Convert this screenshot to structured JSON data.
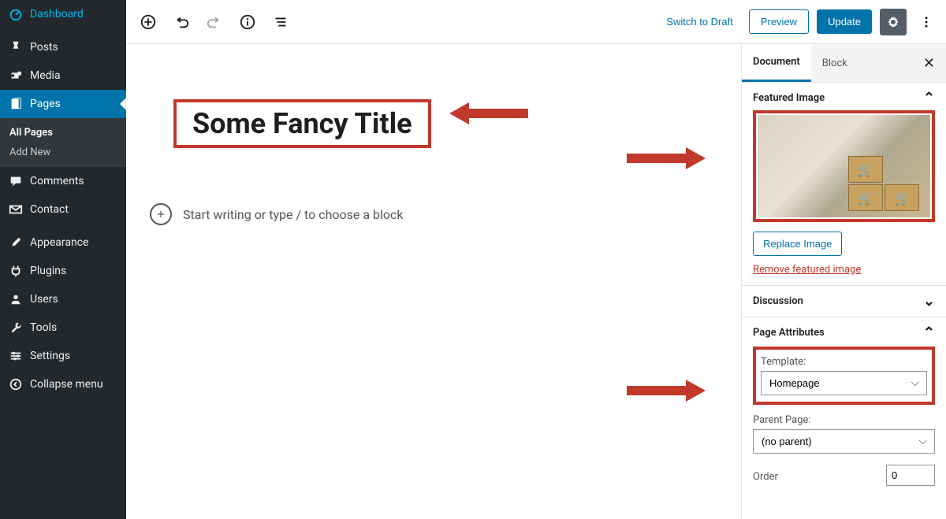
{
  "sidebar": {
    "items": [
      {
        "label": "Dashboard",
        "icon": "gauge"
      },
      {
        "label": "Posts",
        "icon": "pin"
      },
      {
        "label": "Media",
        "icon": "media"
      },
      {
        "label": "Pages",
        "icon": "page",
        "active": true
      },
      {
        "label": "Comments",
        "icon": "comment"
      },
      {
        "label": "Contact",
        "icon": "mail"
      },
      {
        "label": "Appearance",
        "icon": "brush"
      },
      {
        "label": "Plugins",
        "icon": "plug"
      },
      {
        "label": "Users",
        "icon": "user"
      },
      {
        "label": "Tools",
        "icon": "wrench"
      },
      {
        "label": "Settings",
        "icon": "sliders"
      },
      {
        "label": "Collapse menu",
        "icon": "collapse"
      }
    ],
    "submenu": [
      {
        "label": "All Pages",
        "bold": true
      },
      {
        "label": "Add New"
      }
    ]
  },
  "toolbar": {
    "switch_draft": "Switch to Draft",
    "preview": "Preview",
    "update": "Update"
  },
  "editor": {
    "title": "Some Fancy Title",
    "placeholder": "Start writing or type / to choose a block"
  },
  "panel": {
    "tabs": {
      "document": "Document",
      "block": "Block"
    },
    "featured": {
      "heading": "Featured Image",
      "replace": "Replace Image",
      "remove": "Remove featured image"
    },
    "discussion": {
      "heading": "Discussion"
    },
    "attributes": {
      "heading": "Page Attributes",
      "template_label": "Template:",
      "template_value": "Homepage",
      "parent_label": "Parent Page:",
      "parent_value": "(no parent)",
      "order_label": "Order",
      "order_value": "0"
    }
  }
}
